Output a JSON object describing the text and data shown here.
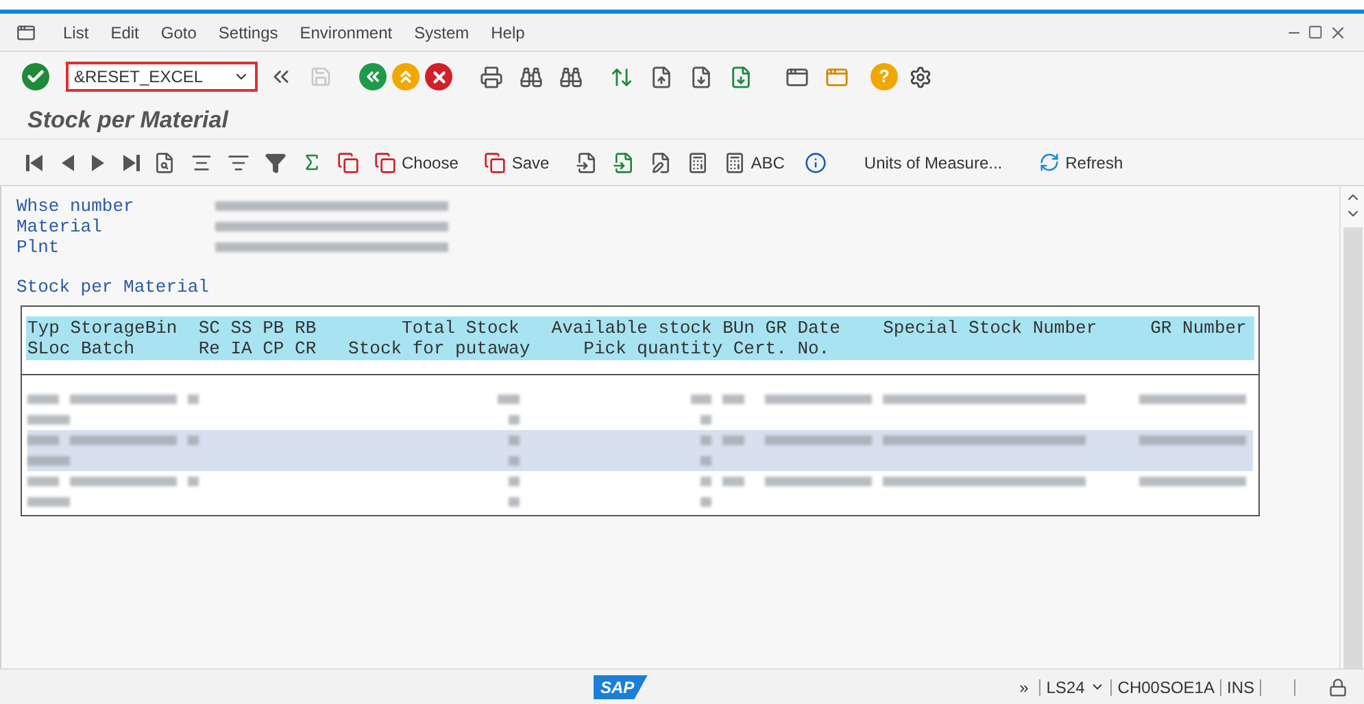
{
  "menu": {
    "items": [
      "List",
      "Edit",
      "Goto",
      "Settings",
      "Environment",
      "System",
      "Help"
    ]
  },
  "command_field": {
    "value": "&RESET_EXCEL"
  },
  "help_button": {
    "symbol": "?"
  },
  "title": "Stock per Material",
  "app_toolbar": {
    "buttons": [
      "Choose",
      "Save",
      "ABC",
      "Units of Measure...",
      "Refresh"
    ]
  },
  "header_fields": [
    {
      "label": "Whse number"
    },
    {
      "label": "Material"
    },
    {
      "label": "Plnt"
    }
  ],
  "section_title": "Stock per Material",
  "table": {
    "header_lines": [
      "Typ StorageBin  SC SS PB RB        Total Stock   Available stock BUn GR Date    Special Stock Number     GR Number",
      "SLoc Batch      Re IA CP CR   Stock for putaway     Pick quantity Cert. No."
    ],
    "rows": [
      {
        "selected": false
      },
      {
        "selected": true
      },
      {
        "selected": false
      }
    ]
  },
  "status_bar": {
    "logo": "SAP",
    "more": "»",
    "transaction": "LS24",
    "server": "CH00SOE1A",
    "mode": "INS"
  }
}
